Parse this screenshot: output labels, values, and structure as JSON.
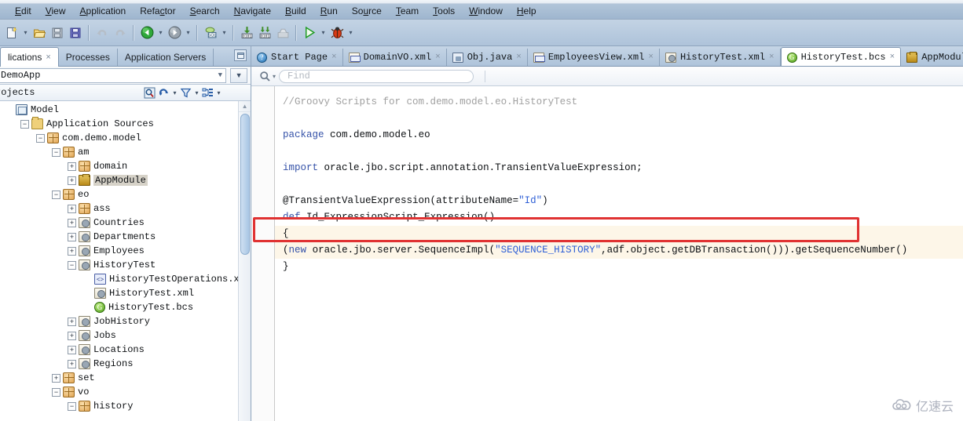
{
  "menubar": {
    "items": [
      {
        "label": "Edit",
        "mnemonic": "E"
      },
      {
        "label": "View",
        "mnemonic": "V"
      },
      {
        "label": "Application",
        "mnemonic": "A"
      },
      {
        "label": "Refactor",
        "mnemonic": "c"
      },
      {
        "label": "Search",
        "mnemonic": "S"
      },
      {
        "label": "Navigate",
        "mnemonic": "N"
      },
      {
        "label": "Build",
        "mnemonic": "B"
      },
      {
        "label": "Run",
        "mnemonic": "R"
      },
      {
        "label": "Source",
        "mnemonic": "u"
      },
      {
        "label": "Team",
        "mnemonic": "T"
      },
      {
        "label": "Tools",
        "mnemonic": "T"
      },
      {
        "label": "Window",
        "mnemonic": "W"
      },
      {
        "label": "Help",
        "mnemonic": "H"
      }
    ]
  },
  "toolbar": {
    "buttons": [
      {
        "name": "new-file-icon",
        "glyph": "❐"
      },
      {
        "name": "open-folder-icon",
        "glyph": "📂"
      },
      {
        "name": "save-icon",
        "glyph": "💾"
      },
      {
        "name": "save-all-icon",
        "glyph": "💾"
      },
      {
        "name": "undo-icon",
        "glyph": "↶"
      },
      {
        "name": "redo-icon",
        "glyph": "↷"
      },
      {
        "name": "navigate-back-icon",
        "glyph": "◀"
      },
      {
        "name": "navigate-forward-icon",
        "glyph": "▶"
      },
      {
        "name": "sql-worksheet-icon",
        "glyph": "SQL"
      },
      {
        "name": "compile-icon",
        "glyph": "0101"
      },
      {
        "name": "rebuild-icon",
        "glyph": "0101"
      },
      {
        "name": "make-icon",
        "glyph": "⚙"
      },
      {
        "name": "run-icon",
        "glyph": "▶"
      },
      {
        "name": "debug-icon",
        "glyph": "🐞"
      }
    ]
  },
  "left_panel": {
    "tabs": [
      {
        "label": "lications",
        "active": true,
        "closable": true
      },
      {
        "label": "Processes",
        "active": false,
        "closable": false
      },
      {
        "label": "Application Servers",
        "active": false,
        "closable": false
      }
    ],
    "application_combo": {
      "value": "DemoApp"
    },
    "projects_label": "rojects",
    "tools": [
      {
        "name": "search-projects-icon"
      },
      {
        "name": "refresh-icon",
        "has_arrow": true
      },
      {
        "name": "filter-icon",
        "has_arrow": true
      },
      {
        "name": "view-options-icon",
        "has_arrow": true
      }
    ],
    "tree": [
      {
        "label": "Model",
        "indent": 0,
        "expander": "none",
        "icon": "model",
        "selected": false
      },
      {
        "label": "Application Sources",
        "indent": 1,
        "expander": "minus",
        "icon": "folder",
        "selected": false
      },
      {
        "label": "com.demo.model",
        "indent": 2,
        "expander": "minus",
        "icon": "pkg",
        "selected": false
      },
      {
        "label": "am",
        "indent": 3,
        "expander": "minus",
        "icon": "pkg",
        "selected": false
      },
      {
        "label": "domain",
        "indent": 4,
        "expander": "plus",
        "icon": "pkg",
        "selected": false
      },
      {
        "label": "AppModule",
        "indent": 4,
        "expander": "plus",
        "icon": "am",
        "selected": true
      },
      {
        "label": "eo",
        "indent": 3,
        "expander": "minus",
        "icon": "pkg",
        "selected": false
      },
      {
        "label": "ass",
        "indent": 4,
        "expander": "plus",
        "icon": "pkg",
        "selected": false
      },
      {
        "label": "Countries",
        "indent": 4,
        "expander": "plus",
        "icon": "eo",
        "selected": false
      },
      {
        "label": "Departments",
        "indent": 4,
        "expander": "plus",
        "icon": "eo",
        "selected": false
      },
      {
        "label": "Employees",
        "indent": 4,
        "expander": "plus",
        "icon": "eo",
        "selected": false
      },
      {
        "label": "HistoryTest",
        "indent": 4,
        "expander": "minus",
        "icon": "eo",
        "selected": false
      },
      {
        "label": "HistoryTestOperations.xml",
        "indent": 5,
        "expander": "none",
        "icon": "xmlop",
        "selected": false
      },
      {
        "label": "HistoryTest.xml",
        "indent": 5,
        "expander": "none",
        "icon": "eo",
        "selected": false
      },
      {
        "label": "HistoryTest.bcs",
        "indent": 5,
        "expander": "none",
        "icon": "bcs",
        "selected": false
      },
      {
        "label": "JobHistory",
        "indent": 4,
        "expander": "plus",
        "icon": "eo",
        "selected": false
      },
      {
        "label": "Jobs",
        "indent": 4,
        "expander": "plus",
        "icon": "eo",
        "selected": false
      },
      {
        "label": "Locations",
        "indent": 4,
        "expander": "plus",
        "icon": "eo",
        "selected": false
      },
      {
        "label": "Regions",
        "indent": 4,
        "expander": "plus",
        "icon": "eo",
        "selected": false
      },
      {
        "label": "set",
        "indent": 3,
        "expander": "plus",
        "icon": "pkg",
        "selected": false
      },
      {
        "label": "vo",
        "indent": 3,
        "expander": "minus",
        "icon": "pkg",
        "selected": false
      },
      {
        "label": "history",
        "indent": 4,
        "expander": "minus",
        "icon": "pkg",
        "selected": false
      }
    ]
  },
  "editor": {
    "tabs": [
      {
        "label": "Start Page",
        "icon": "start",
        "active": false,
        "closable": true
      },
      {
        "label": "DomainVO.xml",
        "icon": "xml",
        "active": false,
        "closable": true
      },
      {
        "label": "Obj.java",
        "icon": "java",
        "active": false,
        "closable": true
      },
      {
        "label": "EmployeesView.xml",
        "icon": "xml",
        "active": false,
        "closable": true
      },
      {
        "label": "HistoryTest.xml",
        "icon": "eo",
        "active": false,
        "closable": true
      },
      {
        "label": "HistoryTest.bcs",
        "icon": "bcs",
        "active": true,
        "closable": true
      },
      {
        "label": "AppModule.xml",
        "icon": "am",
        "active": false,
        "closable": false
      }
    ],
    "find": {
      "placeholder": "Find",
      "value": ""
    },
    "code_lines": [
      {
        "type": "comment",
        "text": "//Groovy Scripts for com.demo.model.eo.HistoryTest"
      },
      {
        "type": "blank",
        "text": ""
      },
      {
        "type": "kw_rest",
        "kw": "package",
        "rest": " com.demo.model.eo"
      },
      {
        "type": "blank",
        "text": ""
      },
      {
        "type": "kw_rest",
        "kw": "import",
        "rest": " oracle.jbo.script.annotation.TransientValueExpression;"
      },
      {
        "type": "blank",
        "text": ""
      },
      {
        "type": "annot",
        "pre": "@TransientValueExpression(attributeName=",
        "str": "\"Id\"",
        "post": ")"
      },
      {
        "type": "kw_rest",
        "kw": "def",
        "rest": " Id_ExpressionScript_Expression()"
      },
      {
        "type": "plain",
        "text": "{",
        "highlight": true
      },
      {
        "type": "code",
        "pre": "(",
        "kw": "new",
        "mid": " oracle.jbo.server.SequenceImpl(",
        "str": "\"SEQUENCE_HISTORY\"",
        "post": ",adf.object.getDBTransaction())).getSequenceNumber()",
        "highlight": true
      },
      {
        "type": "plain",
        "text": "}",
        "highlight": false
      }
    ],
    "highlight_box_color": "#e03232"
  },
  "watermark": {
    "text": "亿速云"
  }
}
